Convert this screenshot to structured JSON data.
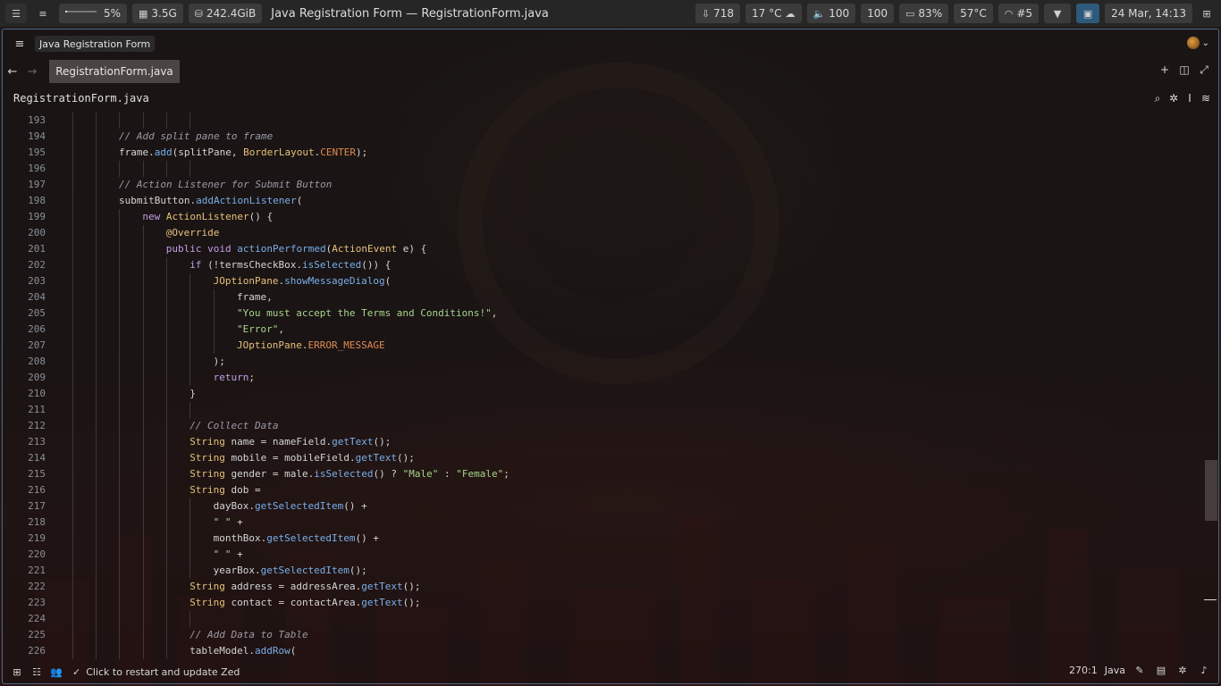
{
  "topbar": {
    "cpu_usage": "5%",
    "cpu_fraction": 0.05,
    "memory": "3.5G",
    "disk": "242.4GiB",
    "window_title": "Java Registration Form — RegistrationForm.java",
    "updates": "718",
    "weather": "17 °C",
    "volume": "100",
    "brightness": "100",
    "battery": "83%",
    "temperature": "57°C",
    "wifi": "#5",
    "datetime": "24 Mar, 14:13"
  },
  "editor": {
    "project_name": "Java Registration Form",
    "tab_label": "RegistrationForm.java",
    "breadcrumb": "RegistrationForm.java"
  },
  "code_lines": [
    {
      "n": "193",
      "indent": 0,
      "tokens": []
    },
    {
      "n": "194",
      "indent": 1,
      "tokens": [
        [
          "com",
          "// Add split pane to frame"
        ]
      ]
    },
    {
      "n": "195",
      "indent": 1,
      "tokens": [
        [
          "txt",
          "frame."
        ],
        [
          "fn",
          "add"
        ],
        [
          "txt",
          "(splitPane, "
        ],
        [
          "type",
          "BorderLayout"
        ],
        [
          "txt",
          "."
        ],
        [
          "const",
          "CENTER"
        ],
        [
          "txt",
          ");"
        ]
      ]
    },
    {
      "n": "196",
      "indent": 0,
      "tokens": []
    },
    {
      "n": "197",
      "indent": 1,
      "tokens": [
        [
          "com",
          "// Action Listener for Submit Button"
        ]
      ]
    },
    {
      "n": "198",
      "indent": 1,
      "tokens": [
        [
          "txt",
          "submitButton."
        ],
        [
          "fn",
          "addActionListener"
        ],
        [
          "txt",
          "("
        ]
      ]
    },
    {
      "n": "199",
      "indent": 2,
      "tokens": [
        [
          "kw",
          "new "
        ],
        [
          "type",
          "ActionListener"
        ],
        [
          "txt",
          "() {"
        ]
      ]
    },
    {
      "n": "200",
      "indent": 3,
      "tokens": [
        [
          "ann",
          "@Override"
        ]
      ]
    },
    {
      "n": "201",
      "indent": 3,
      "tokens": [
        [
          "kw",
          "public void "
        ],
        [
          "fn",
          "actionPerformed"
        ],
        [
          "txt",
          "("
        ],
        [
          "type",
          "ActionEvent"
        ],
        [
          "txt",
          " e) {"
        ]
      ]
    },
    {
      "n": "202",
      "indent": 4,
      "tokens": [
        [
          "kw",
          "if "
        ],
        [
          "txt",
          "(!termsCheckBox."
        ],
        [
          "fn",
          "isSelected"
        ],
        [
          "txt",
          "()) {"
        ]
      ]
    },
    {
      "n": "203",
      "indent": 5,
      "tokens": [
        [
          "type",
          "JOptionPane"
        ],
        [
          "txt",
          "."
        ],
        [
          "fn",
          "showMessageDialog"
        ],
        [
          "txt",
          "("
        ]
      ]
    },
    {
      "n": "204",
      "indent": 6,
      "tokens": [
        [
          "txt",
          "frame,"
        ]
      ]
    },
    {
      "n": "205",
      "indent": 6,
      "tokens": [
        [
          "str",
          "\"You must accept the Terms and Conditions!\""
        ],
        [
          "txt",
          ","
        ]
      ]
    },
    {
      "n": "206",
      "indent": 6,
      "tokens": [
        [
          "str",
          "\"Error\""
        ],
        [
          "txt",
          ","
        ]
      ]
    },
    {
      "n": "207",
      "indent": 6,
      "tokens": [
        [
          "type",
          "JOptionPane"
        ],
        [
          "txt",
          "."
        ],
        [
          "const",
          "ERROR_MESSAGE"
        ]
      ]
    },
    {
      "n": "208",
      "indent": 5,
      "tokens": [
        [
          "txt",
          ");"
        ]
      ]
    },
    {
      "n": "209",
      "indent": 5,
      "tokens": [
        [
          "kw",
          "return"
        ],
        [
          "txt",
          ";"
        ]
      ]
    },
    {
      "n": "210",
      "indent": 4,
      "tokens": [
        [
          "txt",
          "}"
        ]
      ]
    },
    {
      "n": "211",
      "indent": 0,
      "tokens": []
    },
    {
      "n": "212",
      "indent": 4,
      "tokens": [
        [
          "com",
          "// Collect Data"
        ]
      ]
    },
    {
      "n": "213",
      "indent": 4,
      "tokens": [
        [
          "type",
          "String"
        ],
        [
          "txt",
          " name = nameField."
        ],
        [
          "fn",
          "getText"
        ],
        [
          "txt",
          "();"
        ]
      ]
    },
    {
      "n": "214",
      "indent": 4,
      "tokens": [
        [
          "type",
          "String"
        ],
        [
          "txt",
          " mobile = mobileField."
        ],
        [
          "fn",
          "getText"
        ],
        [
          "txt",
          "();"
        ]
      ]
    },
    {
      "n": "215",
      "indent": 4,
      "tokens": [
        [
          "type",
          "String"
        ],
        [
          "txt",
          " gender = male."
        ],
        [
          "fn",
          "isSelected"
        ],
        [
          "txt",
          "() ? "
        ],
        [
          "str",
          "\"Male\""
        ],
        [
          "txt",
          " : "
        ],
        [
          "str",
          "\"Female\""
        ],
        [
          "txt",
          ";"
        ]
      ]
    },
    {
      "n": "216",
      "indent": 4,
      "tokens": [
        [
          "type",
          "String"
        ],
        [
          "txt",
          " dob ="
        ]
      ]
    },
    {
      "n": "217",
      "indent": 5,
      "tokens": [
        [
          "txt",
          "dayBox."
        ],
        [
          "fn",
          "getSelectedItem"
        ],
        [
          "txt",
          "() +"
        ]
      ]
    },
    {
      "n": "218",
      "indent": 5,
      "tokens": [
        [
          "str",
          "\" \""
        ],
        [
          "txt",
          " +"
        ]
      ]
    },
    {
      "n": "219",
      "indent": 5,
      "tokens": [
        [
          "txt",
          "monthBox."
        ],
        [
          "fn",
          "getSelectedItem"
        ],
        [
          "txt",
          "() +"
        ]
      ]
    },
    {
      "n": "220",
      "indent": 5,
      "tokens": [
        [
          "str",
          "\" \""
        ],
        [
          "txt",
          " +"
        ]
      ]
    },
    {
      "n": "221",
      "indent": 5,
      "tokens": [
        [
          "txt",
          "yearBox."
        ],
        [
          "fn",
          "getSelectedItem"
        ],
        [
          "txt",
          "();"
        ]
      ]
    },
    {
      "n": "222",
      "indent": 4,
      "tokens": [
        [
          "type",
          "String"
        ],
        [
          "txt",
          " address = addressArea."
        ],
        [
          "fn",
          "getText"
        ],
        [
          "txt",
          "();"
        ]
      ]
    },
    {
      "n": "223",
      "indent": 4,
      "tokens": [
        [
          "type",
          "String"
        ],
        [
          "txt",
          " contact = contactArea."
        ],
        [
          "fn",
          "getText"
        ],
        [
          "txt",
          "();"
        ]
      ]
    },
    {
      "n": "224",
      "indent": 0,
      "tokens": []
    },
    {
      "n": "225",
      "indent": 4,
      "tokens": [
        [
          "com",
          "// Add Data to Table"
        ]
      ]
    },
    {
      "n": "226",
      "indent": 4,
      "tokens": [
        [
          "txt",
          "tableModel."
        ],
        [
          "fn",
          "addRow"
        ],
        [
          "txt",
          "("
        ]
      ]
    }
  ],
  "statusbar": {
    "update_message": "Click to restart and update Zed",
    "cursor_position": "270:1",
    "language": "Java"
  },
  "icons": {
    "sidebar_toggle": "hamburger-icon",
    "back": "arrow-left-icon",
    "forward": "arrow-right-icon",
    "new_tab": "plus-icon",
    "split": "split-pane-icon",
    "zoom": "maximize-icon",
    "search": "search-icon",
    "assistant": "sparkle-icon",
    "inline": "text-cursor-icon",
    "settings": "sliders-icon"
  },
  "colors": {
    "accent_border": "#4a6a8a",
    "keyword": "#c49ee6",
    "function": "#79aee8",
    "type": "#e6c07b",
    "string": "#a7d48c",
    "comment": "#9a9aa6",
    "constant": "#e08a52"
  }
}
